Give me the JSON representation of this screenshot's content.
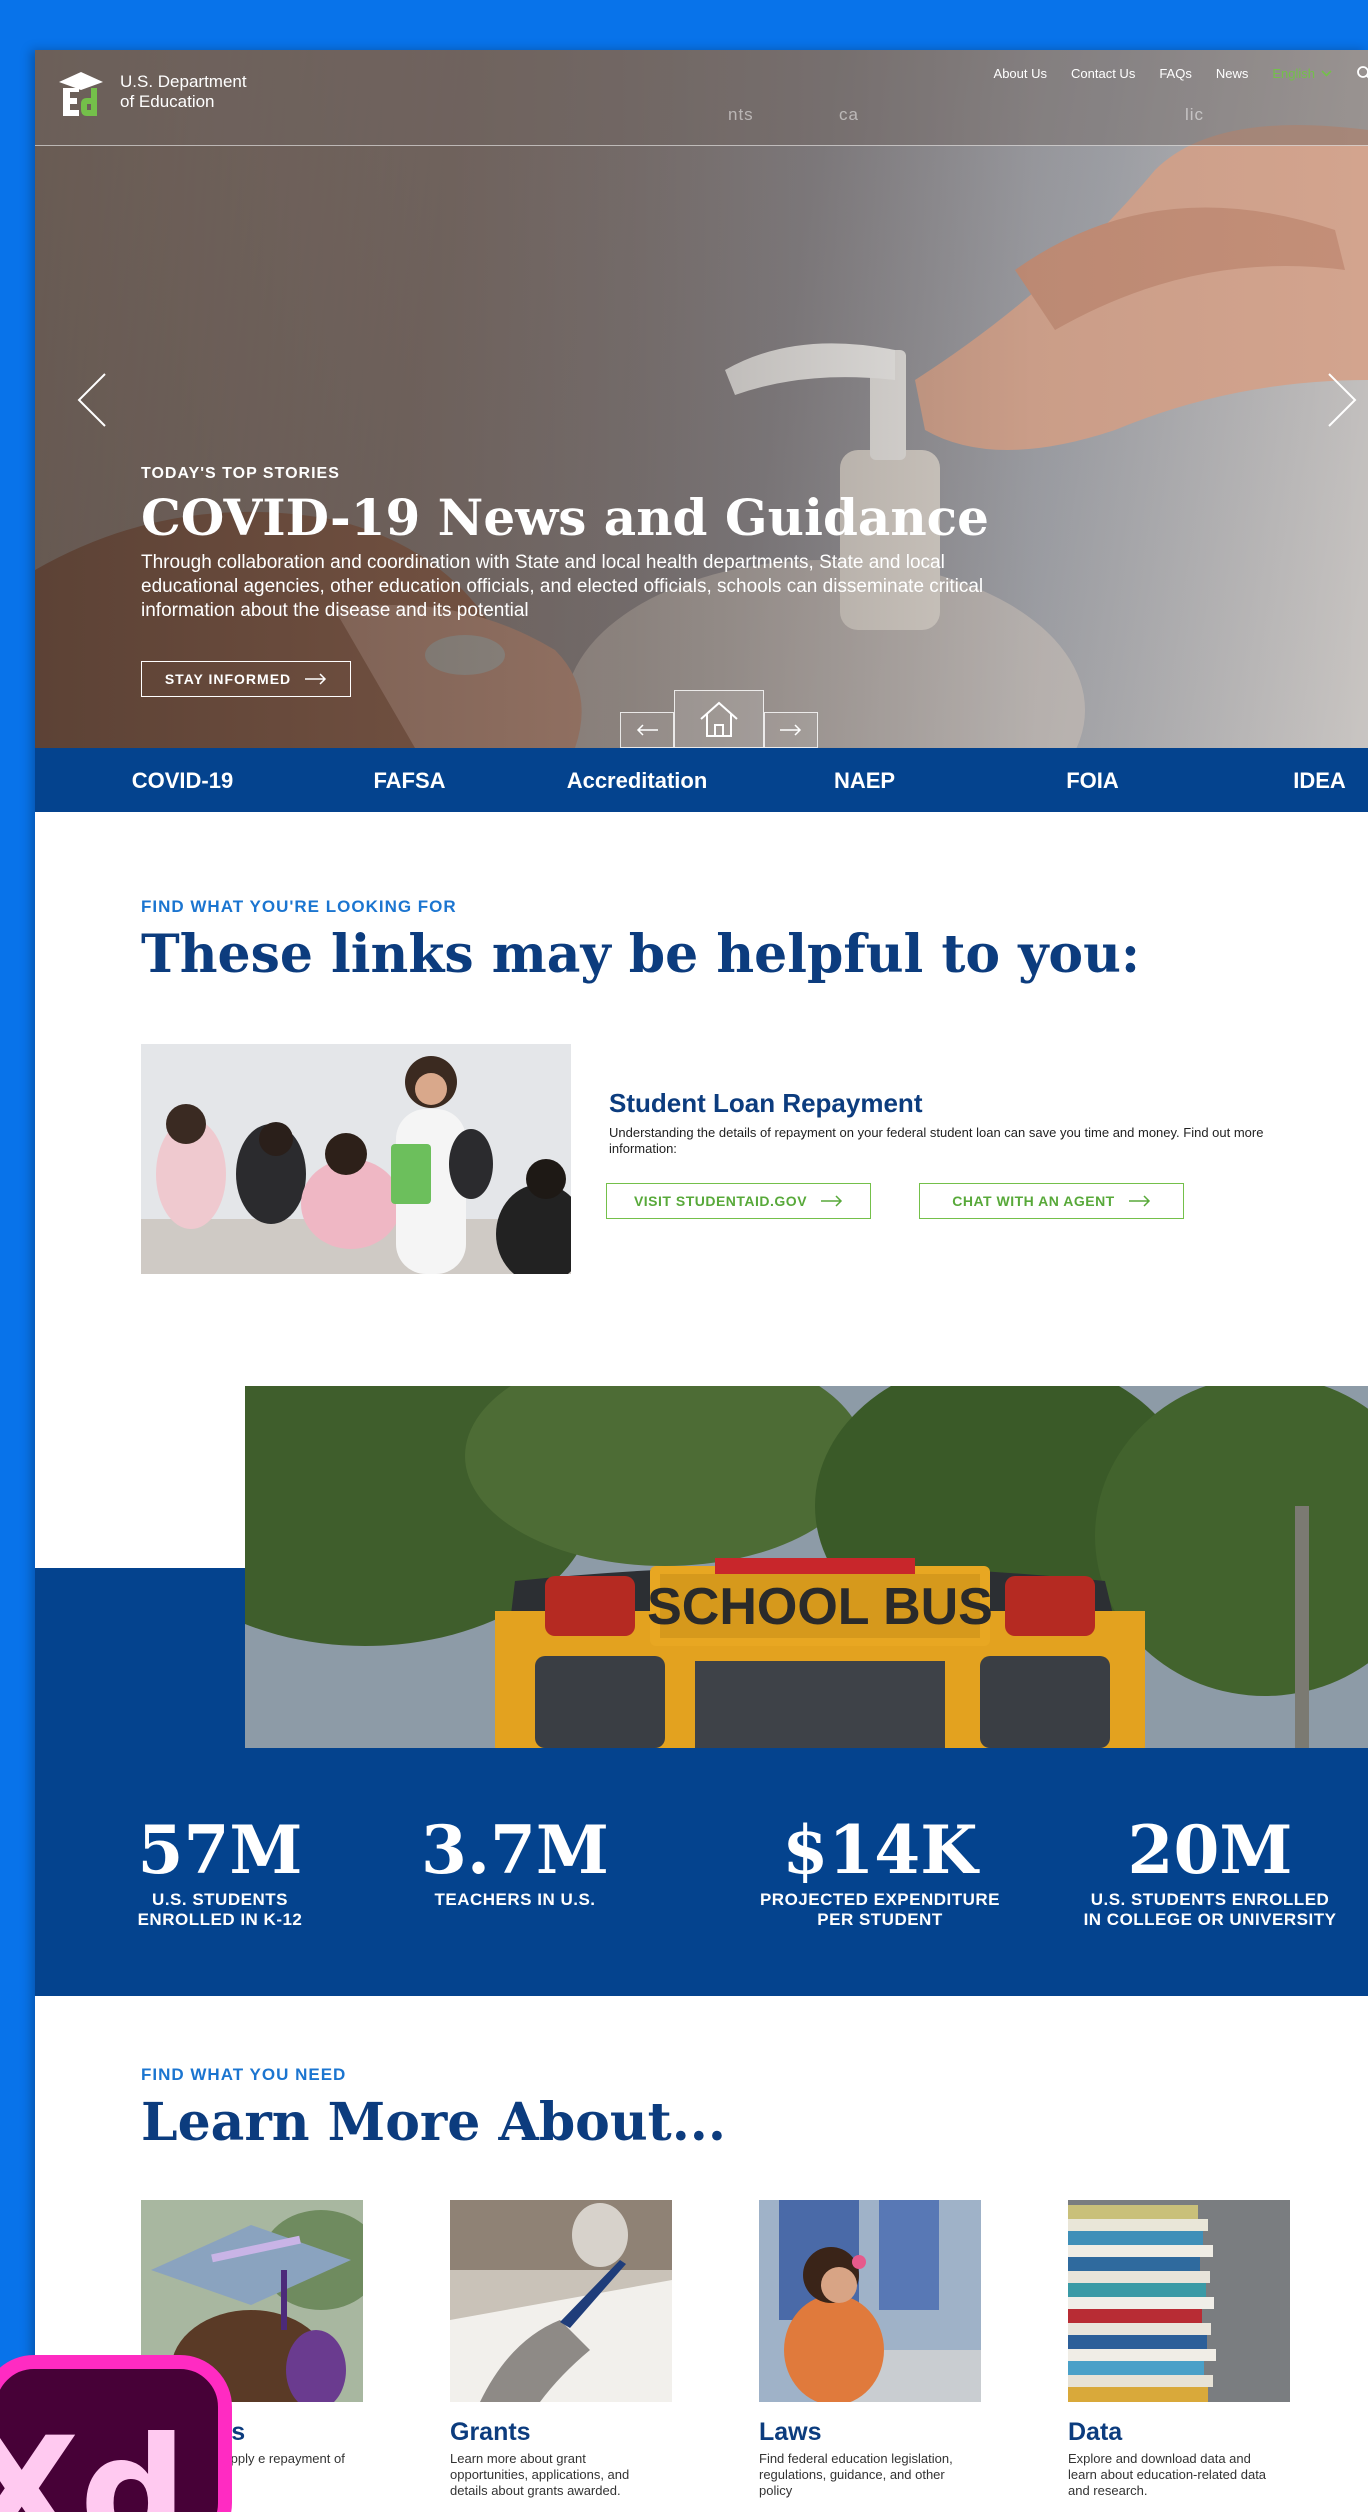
{
  "header": {
    "logo_lines": [
      "U.S. Department",
      "of Education"
    ],
    "utility": [
      "About Us",
      "Contact Us",
      "FAQs",
      "News"
    ],
    "language": "English",
    "ghost_nav": [
      "nts",
      "ca",
      "lic"
    ]
  },
  "hero": {
    "eyebrow": "TODAY'S TOP STORIES",
    "title": "COVID-19 News and Guidance",
    "body": "Through collaboration and coordination with State and local health departments, State and local educational agencies, other education officials, and elected officials, schools can disseminate critical information about the disease and its potential",
    "button": "STAY INFORMED"
  },
  "topics": [
    "COVID-19",
    "FAFSA",
    "Accreditation",
    "NAEP",
    "FOIA",
    "IDEA"
  ],
  "helpful": {
    "eyebrow": "FIND WHAT YOU'RE LOOKING FOR",
    "title": "These links may be helpful to you:",
    "item_title": "Student Loan Repayment",
    "item_desc": "Understanding the details of repayment on your federal student loan can save you time and money. Find out more information:",
    "btn_primary": "VISIT STUDENTAID.GOV",
    "btn_secondary": "CHAT WITH AN AGENT"
  },
  "stats": [
    {
      "value": "57M",
      "label_lines": [
        "U.S. STUDENTS",
        "ENROLLED IN K-12"
      ]
    },
    {
      "value": "3.7M",
      "label_lines": [
        "TEACHERS IN U.S.",
        ""
      ]
    },
    {
      "value": "$14K",
      "label_lines": [
        "PROJECTED EXPENDITURE",
        "PER STUDENT"
      ]
    },
    {
      "value": "20M",
      "label_lines": [
        "U.S. STUDENTS ENROLLED",
        "IN COLLEGE OR UNIVERSITY"
      ]
    }
  ],
  "learn": {
    "eyebrow": "FIND WHAT YOU NEED",
    "title": "Learn More About...",
    "cards": [
      {
        "title": "nt Loans",
        "desc": "o you need to apply e repayment of your nt loans."
      },
      {
        "title": "Grants",
        "desc": "Learn more about grant opportunities, applications, and details about grants awarded."
      },
      {
        "title": "Laws",
        "desc": "Find federal education legislation, regulations, guidance, and other policy"
      },
      {
        "title": "Data",
        "desc": "Explore and download data and learn about education-related data and research."
      }
    ]
  },
  "badge": {
    "text": "Xd"
  },
  "colors": {
    "navy": "#04438e",
    "accent_blue": "#1b75d0",
    "green": "#74c04a",
    "canvas": "#0873ea",
    "badge_pink": "#ff2bc2"
  }
}
